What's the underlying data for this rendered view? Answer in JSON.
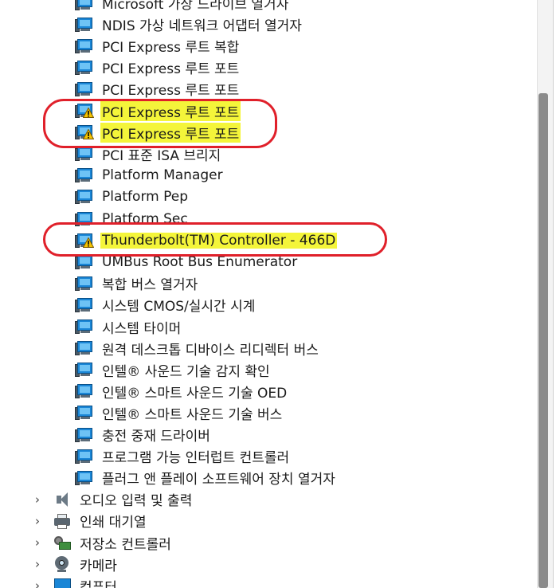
{
  "tree": {
    "children": [
      {
        "label": "Microsoft 가상 드라이브 열거자",
        "warning": false,
        "highlight": false
      },
      {
        "label": "NDIS 가상 네트워크 어댑터 열거자",
        "warning": false,
        "highlight": false
      },
      {
        "label": "PCI Express 루트 복합",
        "warning": false,
        "highlight": false
      },
      {
        "label": "PCI Express 루트 포트",
        "warning": false,
        "highlight": false
      },
      {
        "label": "PCI Express 루트 포트",
        "warning": false,
        "highlight": false
      },
      {
        "label": "PCI Express 루트 포트",
        "warning": true,
        "highlight": true
      },
      {
        "label": "PCI Express 루트 포트",
        "warning": true,
        "highlight": true
      },
      {
        "label": "PCI 표준 ISA 브리지",
        "warning": false,
        "highlight": false
      },
      {
        "label": "Platform Manager",
        "warning": false,
        "highlight": false
      },
      {
        "label": "Platform Pep",
        "warning": false,
        "highlight": false
      },
      {
        "label": "Platform Sec",
        "warning": false,
        "highlight": false
      },
      {
        "label": "Thunderbolt(TM) Controller - 466D",
        "warning": true,
        "highlight": true
      },
      {
        "label": "UMBus Root Bus Enumerator",
        "warning": false,
        "highlight": false
      },
      {
        "label": "복합 버스 열거자",
        "warning": false,
        "highlight": false
      },
      {
        "label": "시스템 CMOS/실시간 시계",
        "warning": false,
        "highlight": false
      },
      {
        "label": "시스템 타이머",
        "warning": false,
        "highlight": false
      },
      {
        "label": "원격 데스크톱 디바이스 리디렉터 버스",
        "warning": false,
        "highlight": false
      },
      {
        "label": "인텔® 사운드 기술 감지 확인",
        "warning": false,
        "highlight": false
      },
      {
        "label": "인텔® 스마트 사운드 기술 OED",
        "warning": false,
        "highlight": false
      },
      {
        "label": "인텔® 스마트 사운드 기술 버스",
        "warning": false,
        "highlight": false
      },
      {
        "label": "충전 중재 드라이버",
        "warning": false,
        "highlight": false
      },
      {
        "label": "프로그램 가능 인터럽트 컨트롤러",
        "warning": false,
        "highlight": false
      },
      {
        "label": "플러그 앤 플레이 소프트웨어 장치 열거자",
        "warning": false,
        "highlight": false
      }
    ],
    "categories": [
      {
        "label": "오디오 입력 및 출력",
        "icon": "speaker-icon"
      },
      {
        "label": "인쇄 대기열",
        "icon": "printer-icon"
      },
      {
        "label": "저장소 컨트롤러",
        "icon": "storage-controller-icon"
      },
      {
        "label": "카메라",
        "icon": "camera-icon"
      },
      {
        "label": "컴퓨터",
        "icon": "computer-icon"
      }
    ],
    "expand_glyph": "›"
  },
  "colors": {
    "highlight": "#f4f53a",
    "annotation": "#e0202a",
    "device_blue": "#1a86d6",
    "warning_yellow": "#f5c400"
  }
}
